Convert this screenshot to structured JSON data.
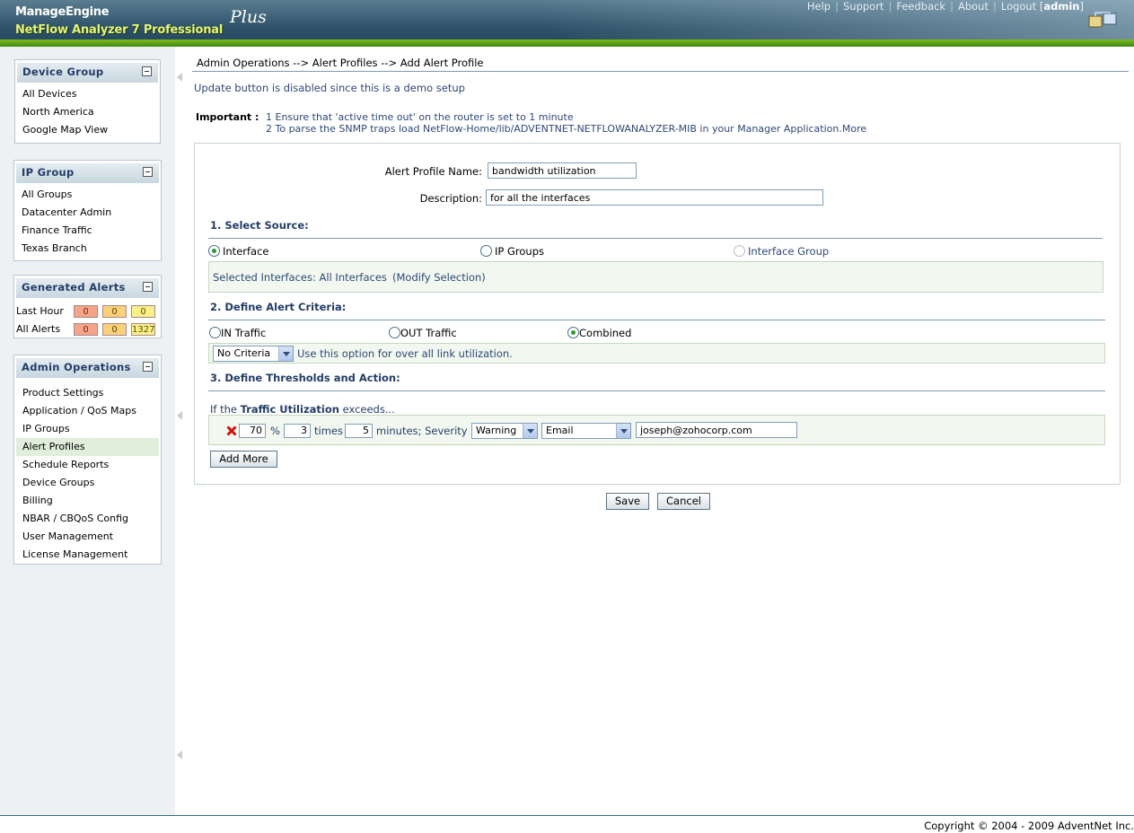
{
  "header": {
    "brand_top": "ManageEngine",
    "brand_product": "NetFlow Analyzer 7 Professional",
    "brand_plus": "Plus",
    "nav": [
      "Help",
      "Support",
      "Feedback",
      "About",
      "Logout"
    ],
    "user": "admin"
  },
  "sidebar": {
    "device_group": {
      "title": "Device Group",
      "items": [
        "All Devices",
        "North America",
        "Google Map View"
      ]
    },
    "ip_group": {
      "title": "IP Group",
      "items": [
        "All Groups",
        "Datacenter Admin",
        "Finance Traffic",
        "Texas Branch"
      ]
    },
    "generated_alerts": {
      "title": "Generated Alerts",
      "rows": [
        {
          "label": "Last Hour",
          "counts": [
            "0",
            "0",
            "0"
          ]
        },
        {
          "label": "All Alerts",
          "counts": [
            "0",
            "0",
            "1327"
          ]
        }
      ]
    },
    "admin_operations": {
      "title": "Admin Operations",
      "items": [
        "Product Settings",
        "Application / QoS Maps",
        "IP Groups",
        "Alert Profiles",
        "Schedule Reports",
        "Device Groups",
        "Billing",
        "NBAR / CBQoS Config",
        "User Management",
        "License Management"
      ],
      "active": "Alert Profiles"
    }
  },
  "main": {
    "breadcrumb": "Admin Operations --> Alert Profiles --> Add Alert Profile",
    "demo_note": "Update button is disabled since this is a demo setup",
    "important_label": "Important :",
    "important_1": "1 Ensure that 'active time out' on the router is set to 1 minute",
    "important_2": "2 To parse the SNMP traps load NetFlow-Home/lib/ADVENTNET-NETFLOWANALYZER-MIB in your Manager Application.More",
    "form": {
      "name_label": "Alert Profile Name:",
      "name_value": "bandwidth utilization",
      "desc_label": "Description:",
      "desc_value": "for all the interfaces",
      "section1": "1. Select Source:",
      "source_options": [
        "Interface",
        "IP Groups",
        "Interface Group"
      ],
      "selected_interfaces_label": "Selected Interfaces: All Interfaces",
      "modify_selection": "(Modify Selection)",
      "section2": "2. Define Alert Criteria:",
      "criteria_options": [
        "IN Traffic",
        "OUT Traffic",
        "Combined"
      ],
      "criteria_select": "No Criteria",
      "criteria_hint": "Use this option for over all link utilization.",
      "section3": "3. Define Thresholds and Action:",
      "threshold_prefix": "If the ",
      "threshold_bold": "Traffic Utilization",
      "threshold_suffix": " exceeds...",
      "percent_value": "70",
      "percent_unit": "%",
      "times_value": "3",
      "times_label": "times",
      "minutes_value": "5",
      "minutes_label": "minutes; Severity",
      "severity": "Warning",
      "action": "Email",
      "email": "joseph@zohocorp.com",
      "add_more": "Add More"
    },
    "save": "Save",
    "cancel": "Cancel"
  },
  "footer": {
    "copyright": "Copyright © 2004 - 2009 AdventNet Inc."
  },
  "colors": {
    "header": "#2e5268",
    "accent_green": "#7dbb1c",
    "section_text": "#233d68",
    "alert_red": "#f4a48a",
    "alert_orange": "#f9d17a",
    "alert_yellow": "#fbf08a"
  }
}
